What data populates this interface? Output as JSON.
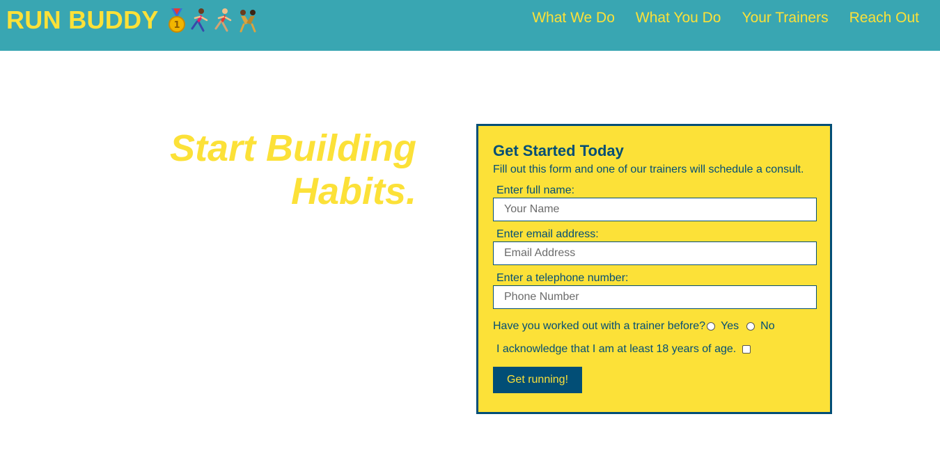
{
  "header": {
    "brand": "RUN BUDDY",
    "brand_icons": [
      "medal-icon",
      "runner-woman-icon",
      "runner-man-icon",
      "wrestlers-icon"
    ],
    "nav": [
      {
        "label": "What We Do"
      },
      {
        "label": "What You Do"
      },
      {
        "label": "Your Trainers"
      },
      {
        "label": "Reach Out"
      }
    ]
  },
  "hero": {
    "line1": "Start Building",
    "line2": "Habits."
  },
  "form": {
    "title": "Get Started Today",
    "description": "Fill out this form and one of our trainers will schedule a consult.",
    "name_label": "Enter full name:",
    "name_placeholder": "Your Name",
    "email_label": "Enter email address:",
    "email_placeholder": "Email Address",
    "phone_label": "Enter a telephone number:",
    "phone_placeholder": "Phone Number",
    "trainer_question": "Have you worked out with a trainer before?",
    "yes_label": "Yes",
    "no_label": "No",
    "age_ack": "I acknowledge that I am at least 18 years of age.",
    "submit_label": "Get running!"
  },
  "colors": {
    "header_bg": "#39a6b2",
    "accent_yellow": "#fce138",
    "navy": "#024e76"
  }
}
